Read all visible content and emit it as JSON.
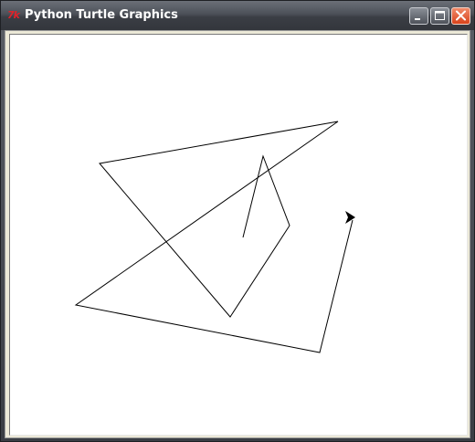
{
  "window": {
    "title": "Python Turtle Graphics",
    "icon": "tk-feather-icon",
    "icon_text": "7k",
    "controls": [
      "minimize",
      "maximize",
      "close"
    ]
  },
  "canvas": {
    "background": "#ffffff",
    "pen_color": "#000000",
    "turtle": {
      "shape": "arrow",
      "heading_deg": 0,
      "color": "#000000"
    }
  },
  "colors": {
    "titlebar": "#4c5058",
    "close_button": "#d8431b",
    "frame": "#3b3f46"
  }
}
